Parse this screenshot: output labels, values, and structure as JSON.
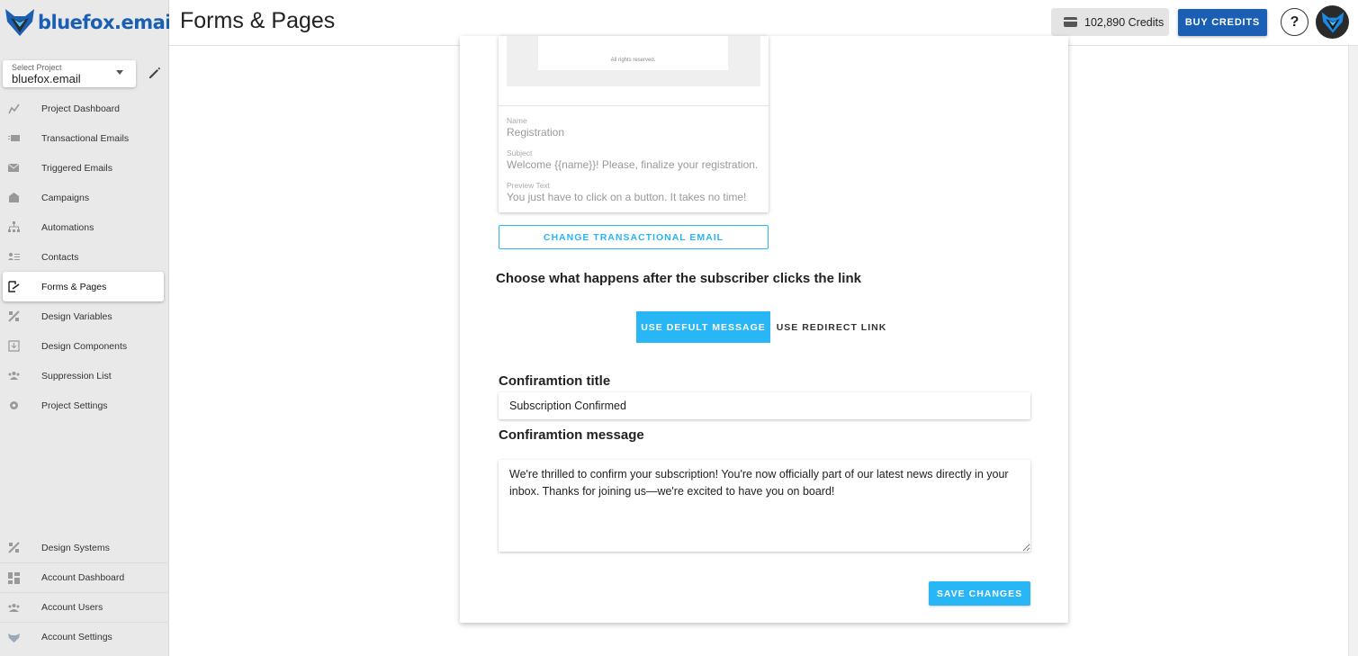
{
  "app": {
    "logo_text": "bluefox.email",
    "page_title": "Forms & Pages"
  },
  "header": {
    "credits_label": "102,890 Credits",
    "buy_label": "BUY CREDITS",
    "help_label": "?"
  },
  "project": {
    "select_label": "Select Project",
    "selected": "bluefox.email"
  },
  "sidebar": {
    "items": [
      {
        "label": "Project Dashboard",
        "icon": "chart-icon"
      },
      {
        "label": "Transactional Emails",
        "icon": "transactional-email-icon"
      },
      {
        "label": "Triggered Emails",
        "icon": "triggered-email-icon"
      },
      {
        "label": "Campaigns",
        "icon": "campaign-icon"
      },
      {
        "label": "Automations",
        "icon": "automation-icon"
      },
      {
        "label": "Contacts",
        "icon": "contacts-icon"
      },
      {
        "label": "Forms & Pages",
        "icon": "forms-icon"
      },
      {
        "label": "Design Variables",
        "icon": "design-variables-icon"
      },
      {
        "label": "Design Components",
        "icon": "design-components-icon"
      },
      {
        "label": "Suppression List",
        "icon": "suppression-icon"
      },
      {
        "label": "Project Settings",
        "icon": "gear-icon"
      }
    ],
    "bottom_items": [
      {
        "label": "Design Systems",
        "icon": "design-systems-icon"
      },
      {
        "label": "Account Dashboard",
        "icon": "dashboard-icon"
      },
      {
        "label": "Account Users",
        "icon": "users-icon"
      },
      {
        "label": "Account Settings",
        "icon": "account-settings-icon"
      }
    ]
  },
  "email_preview": {
    "footer_text": "All rights reserved.",
    "name_label": "Name",
    "name_value": "Registration",
    "subject_label": "Subject",
    "subject_value": "Welcome {{name}}! Please, finalize your registration.",
    "preview_label": "Preview Text",
    "preview_value": "You just have to click on a button. It takes no time!"
  },
  "change_button": "CHANGE TRANSACTIONAL EMAIL",
  "after_click_heading": "Choose what happens after the subscriber clicks the link",
  "toggle": {
    "default_label": "USE DEFULT MESSAGE",
    "redirect_label": "USE REDIRECT LINK"
  },
  "confirmation": {
    "title_label": "Confiramtion title",
    "title_value": "Subscription Confirmed",
    "message_label": "Confiramtion message",
    "message_value": "We're thrilled to confirm your subscription! You're now officially part of our latest news directly in your inbox. Thanks for joining us—we're excited to have you on board!"
  },
  "save_button": "SAVE CHANGES",
  "colors": {
    "brand_blue": "#1a5fb4",
    "accent": "#29b6f6"
  }
}
